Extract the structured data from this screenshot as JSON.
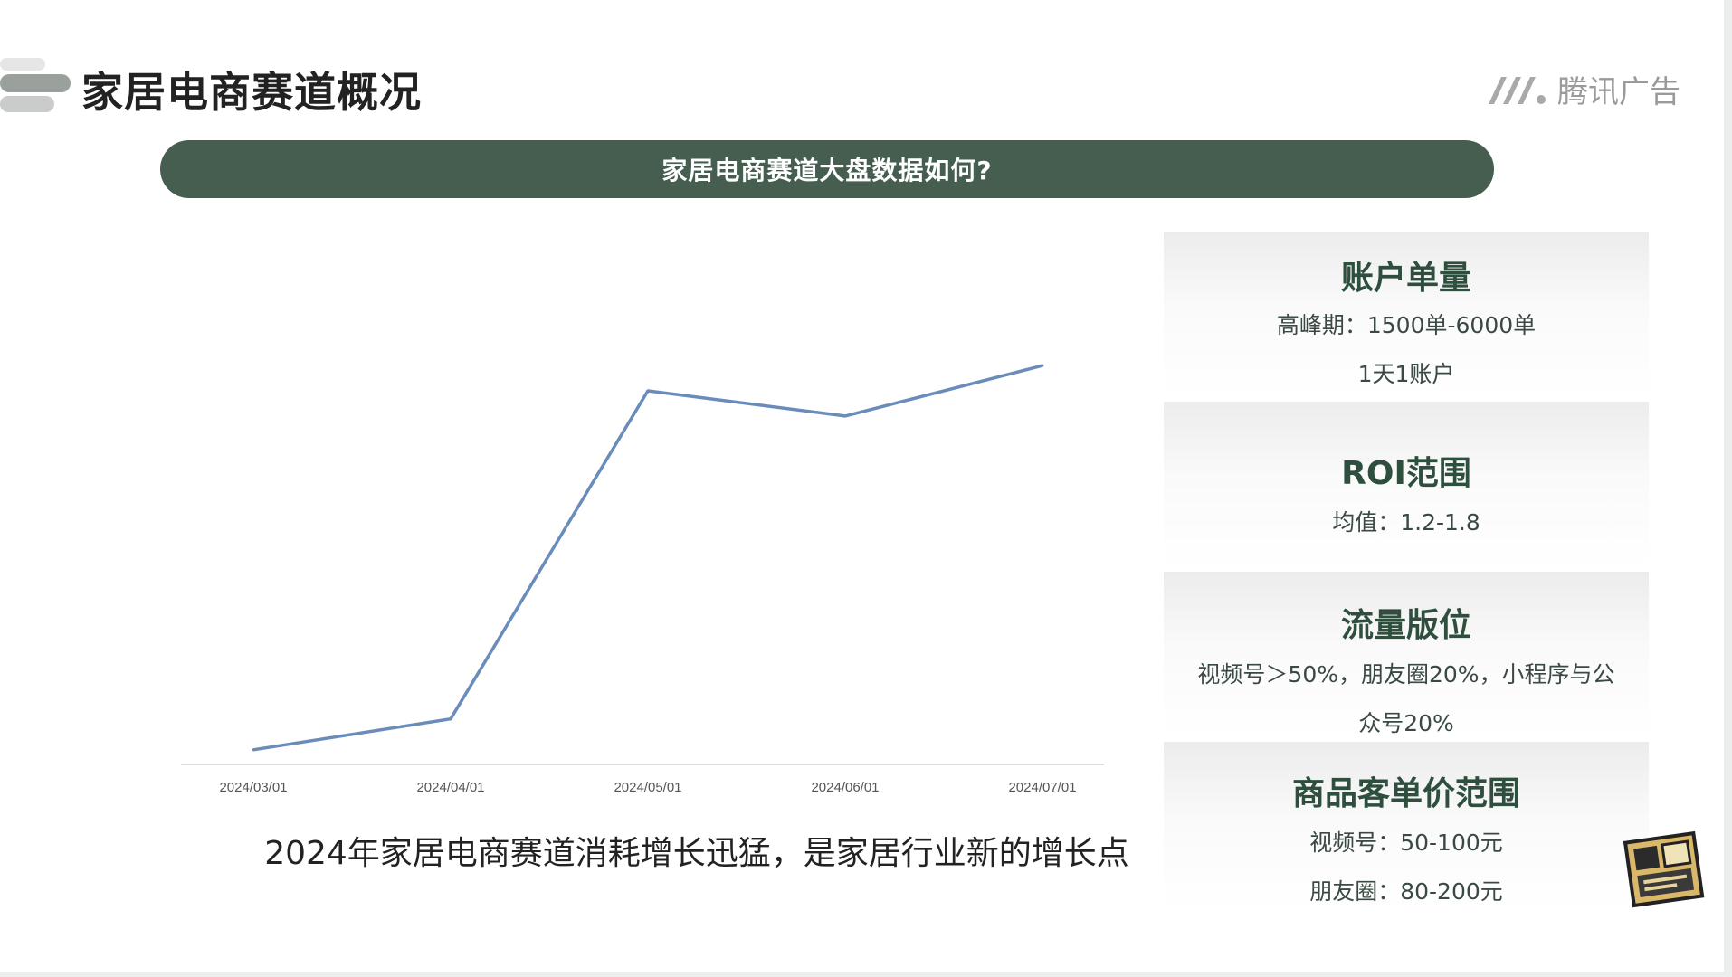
{
  "header": {
    "title": "家居电商赛道概况",
    "brand_name": "腾讯广告",
    "brand_icon": "tencent-ads-logo-icon"
  },
  "banner": {
    "text": "家居电商赛道大盘数据如何?"
  },
  "chart_data": {
    "type": "line",
    "categories": [
      "2024/03/01",
      "2024/04/01",
      "2024/05/01",
      "2024/06/01",
      "2024/07/01"
    ],
    "series": [
      {
        "values": [
          2,
          13,
          130,
          121,
          139
        ],
        "color": "#6a8cba"
      }
    ],
    "ylim": [
      0,
      150
    ],
    "grid": false,
    "xlabel": "",
    "ylabel": ""
  },
  "caption": "2024年家居电商赛道消耗增长迅猛，是家居行业新的增长点",
  "cards": [
    {
      "title": "账户单量",
      "lines": [
        "高峰期：1500单-6000单",
        "1天1账户"
      ]
    },
    {
      "title": "ROI范围",
      "lines": [
        "均值：1.2-1.8"
      ]
    },
    {
      "title": "流量版位",
      "lines": [
        "视频号＞50%，朋友圈20%，小程序与公",
        "众号20%"
      ]
    },
    {
      "title": "商品客单价范围",
      "lines": [
        "视频号：50-100元",
        "朋友圈：80-200元"
      ]
    }
  ],
  "decorations": {
    "stamp_icon": "watermark-stamp-icon",
    "title_icon": "title-stripes-icon"
  },
  "colors": {
    "accent": "#455e50",
    "line": "#6a8cba"
  }
}
